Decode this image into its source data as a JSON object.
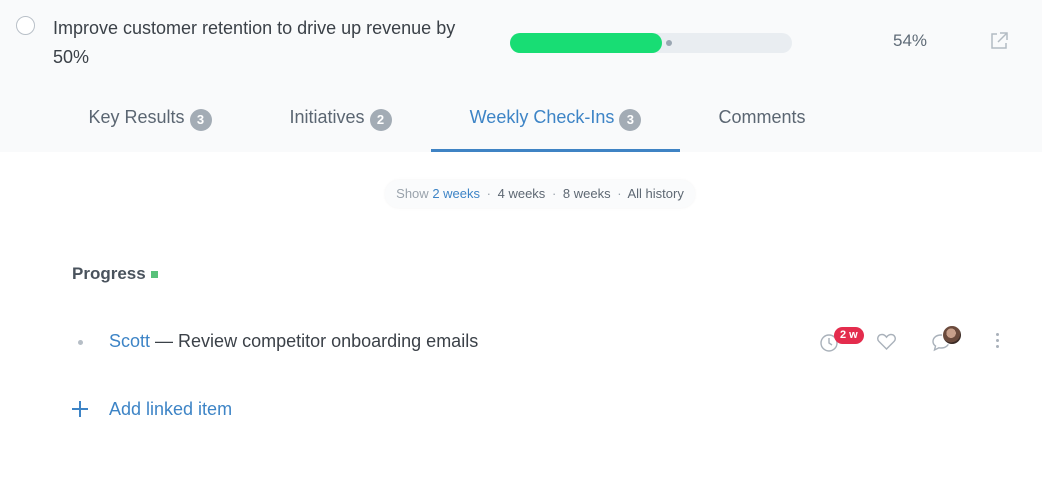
{
  "objective": {
    "title": "Improve customer retention to drive up revenue by 50%",
    "progress": 0.54,
    "progress_label": "54%",
    "progress_color": "#18dd74"
  },
  "tabs": [
    {
      "label": "Key Results",
      "count": "3"
    },
    {
      "label": "Initiatives",
      "count": "2"
    },
    {
      "label": "Weekly Check-Ins",
      "count": "3",
      "active": true
    },
    {
      "label": "Comments"
    }
  ],
  "range": {
    "prefix": "Show",
    "selected": "2 weeks",
    "options": [
      "4 weeks",
      "8 weeks",
      "All history"
    ],
    "separator": "·"
  },
  "section": {
    "title": "Progress",
    "status_color": "#58c17a"
  },
  "items": [
    {
      "owner": "Scott",
      "dash": " — ",
      "text": "Review competitor onboarding emails",
      "age_badge": "2 w"
    }
  ],
  "add_linked_label": "Add linked item",
  "icons": {
    "check": "circle-outline-icon",
    "external": "external-link-icon",
    "clock": "clock-icon",
    "heart": "heart-icon",
    "comment": "comment-icon",
    "more": "more-vertical-icon",
    "add": "plus-icon"
  }
}
